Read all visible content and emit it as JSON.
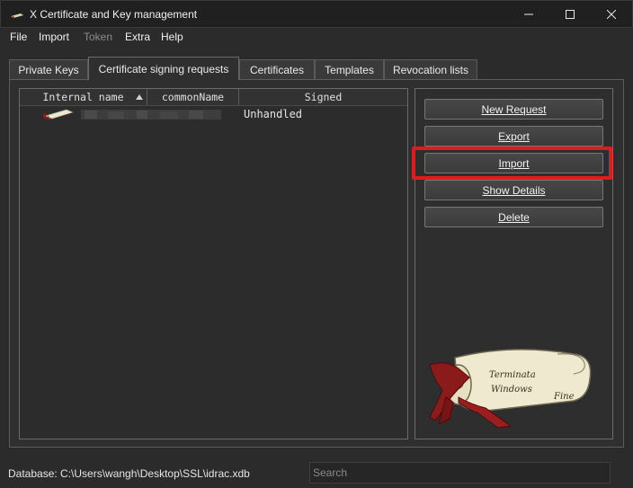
{
  "window": {
    "title": "X Certificate and Key management"
  },
  "menu": {
    "file": "File",
    "import": "Import",
    "token": "Token",
    "extra": "Extra",
    "help": "Help"
  },
  "tabs": [
    "Private Keys",
    "Certificate signing requests",
    "Certificates",
    "Templates",
    "Revocation lists"
  ],
  "active_tab": "Certificate signing requests",
  "table": {
    "columns": [
      "Internal name",
      "commonName",
      "Signed"
    ],
    "sort_column": "Internal name",
    "rows": [
      {
        "internal_name": "",
        "common_name": "",
        "signed": "Unhandled"
      }
    ]
  },
  "buttons": {
    "new_request": "New Request",
    "export": "Export",
    "import": "Import",
    "show_details": "Show Details",
    "delete": "Delete"
  },
  "status": {
    "database": "Database: C:\\Users\\wangh\\Desktop\\SSL\\idrac.xdb"
  },
  "search": {
    "placeholder": "Search"
  },
  "logo": {
    "line1": "Terminata",
    "line2": "Windows",
    "line3": "Fine"
  },
  "colors": {
    "highlight": "#e01b1b",
    "background": "#2b2b2b",
    "seal": "#8b1a1a",
    "parchment": "#efe9cf"
  }
}
